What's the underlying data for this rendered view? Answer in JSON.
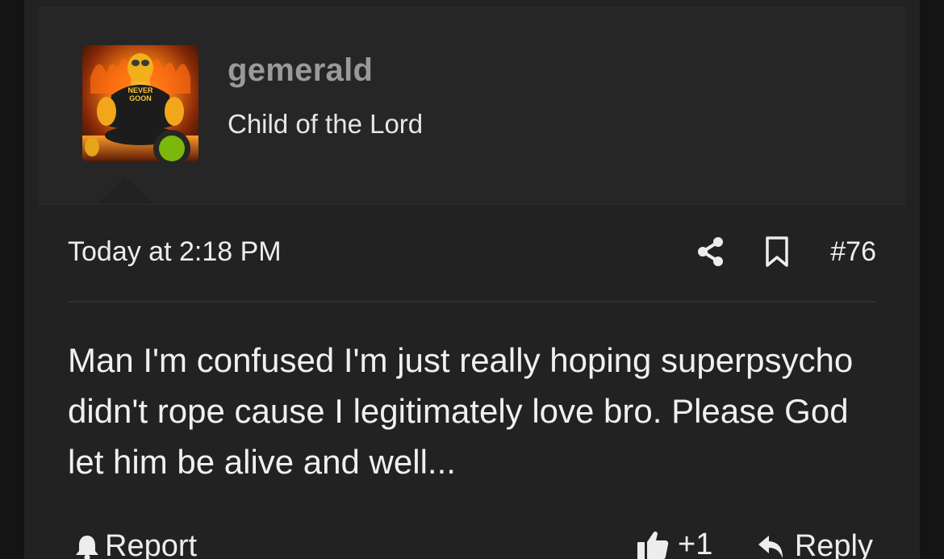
{
  "user": {
    "username": "gemerald",
    "title": "Child of the Lord",
    "avatar_shirt_text_1": "NEVER",
    "avatar_shirt_text_2": "GOON",
    "online_status_color": "#7cb70c"
  },
  "post": {
    "timestamp": "Today at 2:18 PM",
    "number": "#76",
    "message": "Man I'm confused I'm just really hoping superpsycho didn't rope cause I legitimately love bro. Please God let him be alive and well..."
  },
  "actions": {
    "report_label": "Report",
    "like_count": "+1",
    "reply_label": "Reply"
  },
  "icons": {
    "share": "share-icon",
    "bookmark": "bookmark-icon",
    "report": "bell-icon",
    "like": "thumbs-up-icon",
    "reply": "reply-arrow-icon"
  },
  "colors": {
    "page_background": "#141414",
    "post_background": "#222222",
    "user_block_background": "#262626",
    "username": "#9a9a9a",
    "text": "#ededed"
  }
}
